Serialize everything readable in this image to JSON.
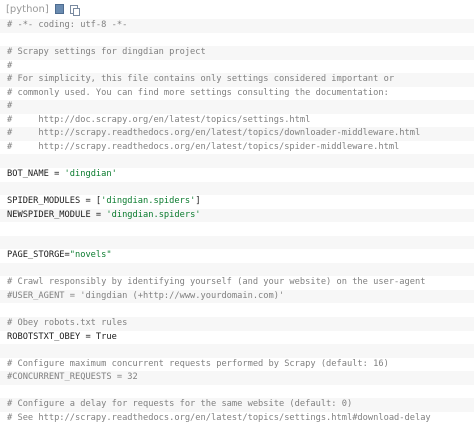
{
  "toolbar": {
    "language_label": "[python]",
    "view_source_icon": "view-source-icon",
    "copy_icon": "copy-icon"
  },
  "code_lines": [
    {
      "segments": [
        {
          "type": "c",
          "text": "# -*- coding: utf-8 -*-"
        }
      ]
    },
    {
      "segments": []
    },
    {
      "segments": [
        {
          "type": "c",
          "text": "# Scrapy settings for dingdian project"
        }
      ]
    },
    {
      "segments": [
        {
          "type": "c",
          "text": "#"
        }
      ]
    },
    {
      "segments": [
        {
          "type": "c",
          "text": "# For simplicity, this file contains only settings considered important or"
        }
      ]
    },
    {
      "segments": [
        {
          "type": "c",
          "text": "# commonly used. You can find more settings consulting the documentation:"
        }
      ]
    },
    {
      "segments": [
        {
          "type": "c",
          "text": "#"
        }
      ]
    },
    {
      "segments": [
        {
          "type": "c",
          "text": "#     http://doc.scrapy.org/en/latest/topics/settings.html"
        }
      ]
    },
    {
      "segments": [
        {
          "type": "c",
          "text": "#     http://scrapy.readthedocs.org/en/latest/topics/downloader-middleware.html"
        }
      ]
    },
    {
      "segments": [
        {
          "type": "c",
          "text": "#     http://scrapy.readthedocs.org/en/latest/topics/spider-middleware.html"
        }
      ]
    },
    {
      "segments": []
    },
    {
      "segments": [
        {
          "type": "v",
          "text": "BOT_NAME = "
        },
        {
          "type": "s",
          "text": "'dingdian'"
        }
      ]
    },
    {
      "segments": []
    },
    {
      "segments": [
        {
          "type": "v",
          "text": "SPIDER_MODULES = ["
        },
        {
          "type": "s",
          "text": "'dingdian.spiders'"
        },
        {
          "type": "v",
          "text": "]"
        }
      ]
    },
    {
      "segments": [
        {
          "type": "v",
          "text": "NEWSPIDER_MODULE = "
        },
        {
          "type": "s",
          "text": "'dingdian.spiders'"
        }
      ]
    },
    {
      "segments": []
    },
    {
      "segments": []
    },
    {
      "segments": [
        {
          "type": "v",
          "text": "PAGE_STORGE="
        },
        {
          "type": "s",
          "text": "\"novels\""
        }
      ]
    },
    {
      "segments": []
    },
    {
      "segments": [
        {
          "type": "c",
          "text": "# Crawl responsibly by identifying yourself (and your website) on the user-agent"
        }
      ]
    },
    {
      "segments": [
        {
          "type": "c",
          "text": "#USER_AGENT = 'dingdian (+http://www.yourdomain.com)'"
        }
      ]
    },
    {
      "segments": []
    },
    {
      "segments": [
        {
          "type": "c",
          "text": "# Obey robots.txt rules"
        }
      ]
    },
    {
      "segments": [
        {
          "type": "v",
          "text": "ROBOTSTXT_OBEY = True"
        }
      ]
    },
    {
      "segments": []
    },
    {
      "segments": [
        {
          "type": "c",
          "text": "# Configure maximum concurrent requests performed by Scrapy (default: 16)"
        }
      ]
    },
    {
      "segments": [
        {
          "type": "c",
          "text": "#CONCURRENT_REQUESTS = 32"
        }
      ]
    },
    {
      "segments": []
    },
    {
      "segments": [
        {
          "type": "c",
          "text": "# Configure a delay for requests for the same website (default: 0)"
        }
      ]
    },
    {
      "segments": [
        {
          "type": "c",
          "text": "# See http://scrapy.readthedocs.org/en/latest/topics/settings.html#download-delay"
        }
      ]
    }
  ]
}
